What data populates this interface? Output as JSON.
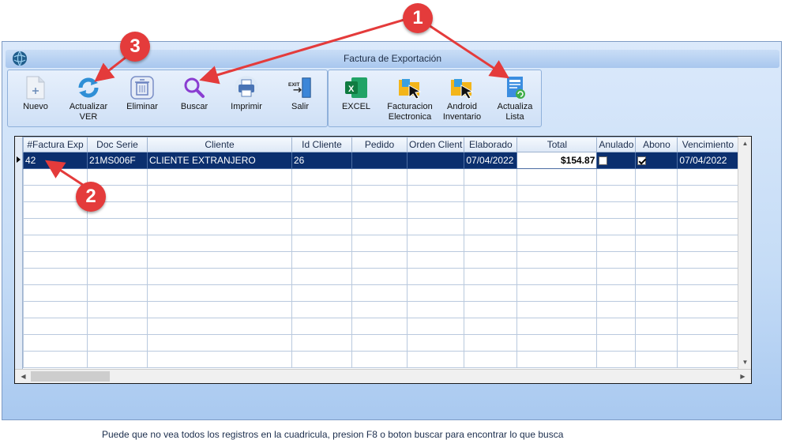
{
  "window": {
    "title": "Factura de Exportación"
  },
  "toolbar_main": [
    {
      "label": "Nuevo",
      "icon": "new-document-icon"
    },
    {
      "label": "Actualizar\nVER",
      "icon": "refresh-icon"
    },
    {
      "label": "Eliminar",
      "icon": "trash-icon"
    },
    {
      "label": "Buscar",
      "icon": "search-icon"
    },
    {
      "label": "Imprimir",
      "icon": "printer-icon"
    },
    {
      "label": "Salir",
      "icon": "exit-icon"
    }
  ],
  "toolbar_extra": [
    {
      "label": "EXCEL",
      "icon": "excel-icon"
    },
    {
      "label": "Facturacion\nElectronica",
      "icon": "folder-cursor-icon"
    },
    {
      "label": "Android\nInventario",
      "icon": "folder-cursor-icon"
    },
    {
      "label": "Actualiza\nLista",
      "icon": "list-refresh-icon"
    }
  ],
  "grid": {
    "columns": [
      "#Factura Exp",
      "Doc Serie",
      "Cliente",
      "Id Cliente",
      "Pedido",
      "Orden Client",
      "Elaborado",
      "Total",
      "Anulado",
      "Abono",
      "Vencimiento"
    ],
    "rows": [
      {
        "factura": "42",
        "doc_serie": "21MS006F",
        "cliente": "CLIENTE EXTRANJERO",
        "id_cliente": "26",
        "pedido": "",
        "orden": "",
        "elaborado": "07/04/2022",
        "total": "$154.87",
        "anulado": false,
        "abono": true,
        "vencimiento": "07/04/2022"
      }
    ]
  },
  "footer_note": "Puede que no vea todos los registros en la cuadricula, presion F8 o boton buscar para encontrar lo que busca",
  "annotations": {
    "badge1": "1",
    "badge2": "2",
    "badge3": "3"
  },
  "colors": {
    "selected_row": "#0b2f6e",
    "badge": "#e43b3b",
    "window_bg": "#c5dcf6"
  }
}
